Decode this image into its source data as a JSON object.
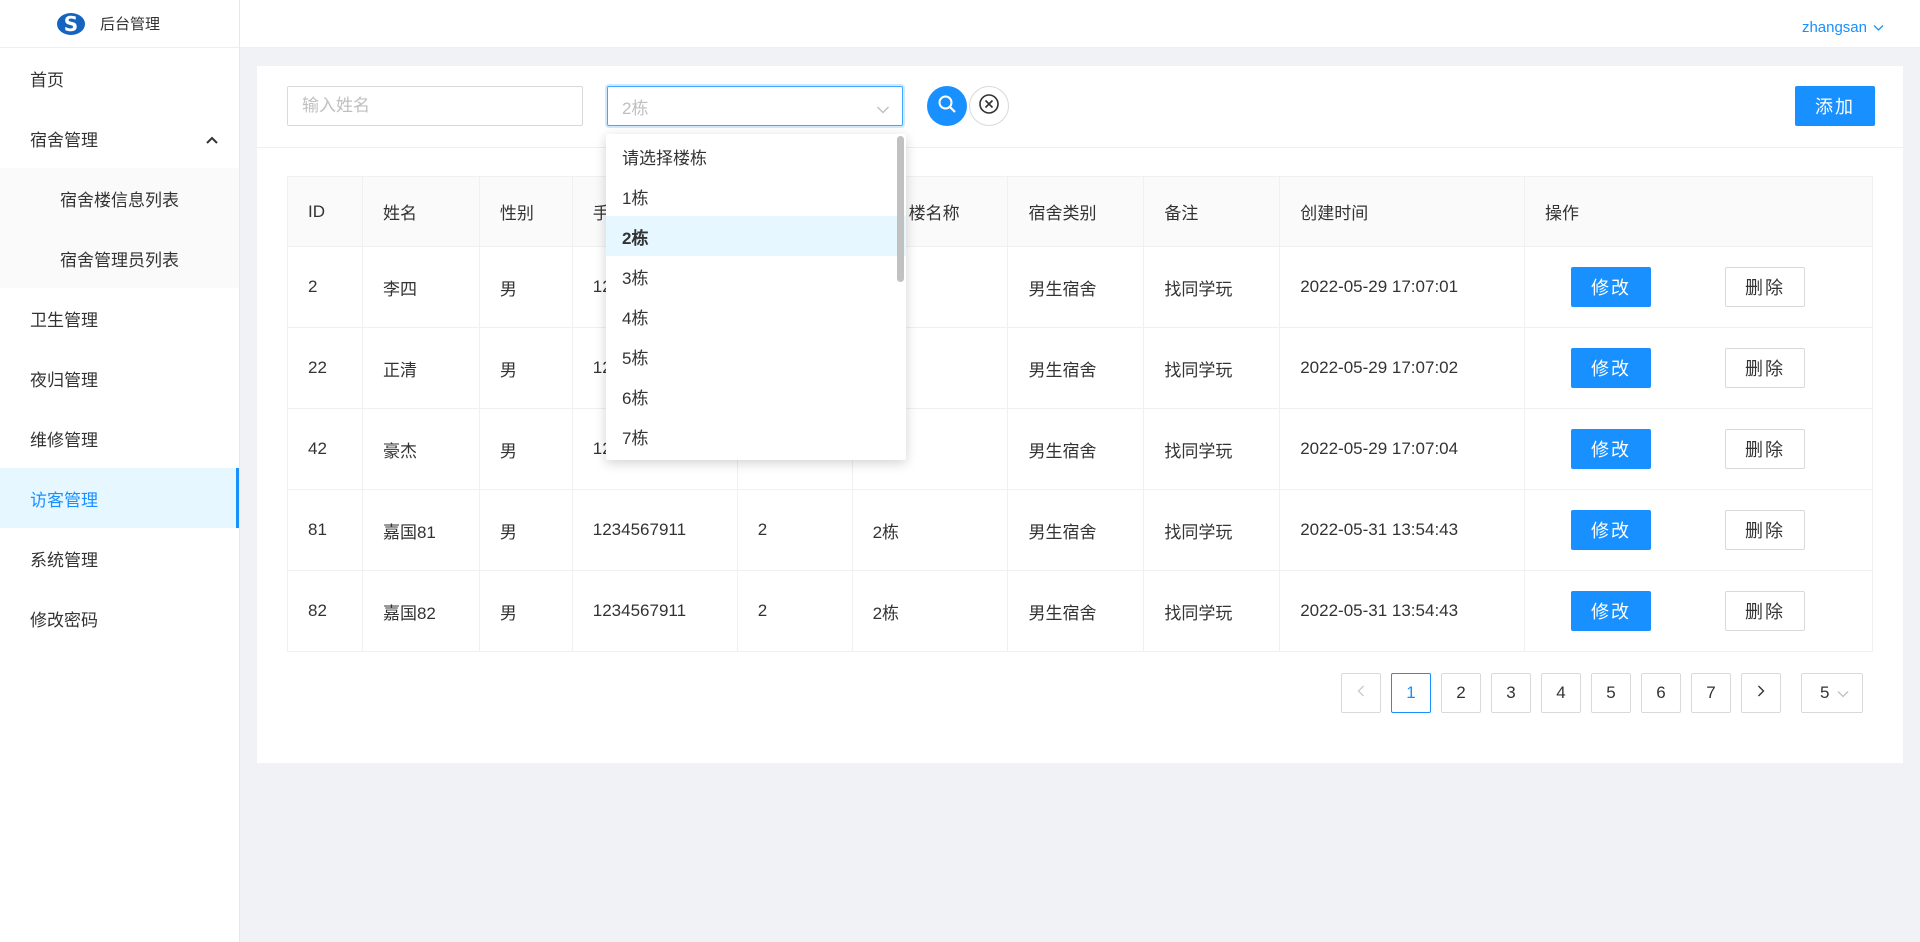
{
  "app": {
    "title": "后台管理"
  },
  "header": {
    "user": "zhangsan"
  },
  "sidebar": {
    "items": [
      {
        "label": "首页"
      },
      {
        "label": "宿舍管理"
      },
      {
        "label": "宿舍楼信息列表"
      },
      {
        "label": "宿舍管理员列表"
      },
      {
        "label": "卫生管理"
      },
      {
        "label": "夜归管理"
      },
      {
        "label": "维修管理"
      },
      {
        "label": "访客管理"
      },
      {
        "label": "系统管理"
      },
      {
        "label": "修改密码"
      }
    ]
  },
  "toolbar": {
    "name_placeholder": "输入姓名",
    "building_value": "2栋",
    "add_label": "添加"
  },
  "dropdown": {
    "options": [
      "请选择楼栋",
      "1栋",
      "2栋",
      "3栋",
      "4栋",
      "5栋",
      "6栋",
      "7栋"
    ],
    "selected": "2栋"
  },
  "table": {
    "headers": [
      "ID",
      "姓名",
      "性别",
      "手",
      "",
      "楼名称",
      "宿舍类别",
      "备注",
      "创建时间",
      "操作"
    ],
    "edit_label": "修改",
    "delete_label": "删除",
    "rows": [
      [
        "2",
        "李四",
        "男",
        "12",
        "",
        "",
        "男生宿舍",
        "找同学玩",
        "2022-05-29 17:07:01"
      ],
      [
        "22",
        "正清",
        "男",
        "12",
        "",
        "",
        "男生宿舍",
        "找同学玩",
        "2022-05-29 17:07:02"
      ],
      [
        "42",
        "豪杰",
        "男",
        "12",
        "",
        "",
        "男生宿舍",
        "找同学玩",
        "2022-05-29 17:07:04"
      ],
      [
        "81",
        "嘉国81",
        "男",
        "1234567911",
        "2",
        "2栋",
        "男生宿舍",
        "找同学玩",
        "2022-05-31 13:54:43"
      ],
      [
        "82",
        "嘉国82",
        "男",
        "1234567911",
        "2",
        "2栋",
        "男生宿舍",
        "找同学玩",
        "2022-05-31 13:54:43"
      ]
    ]
  },
  "pagination": {
    "prev": "<",
    "next": ">",
    "pages": [
      "1",
      "2",
      "3",
      "4",
      "5",
      "6",
      "7"
    ],
    "current": "1",
    "page_size": "5"
  },
  "colors": {
    "accent": "#1890ff",
    "active_bg": "#e6f7ff"
  }
}
